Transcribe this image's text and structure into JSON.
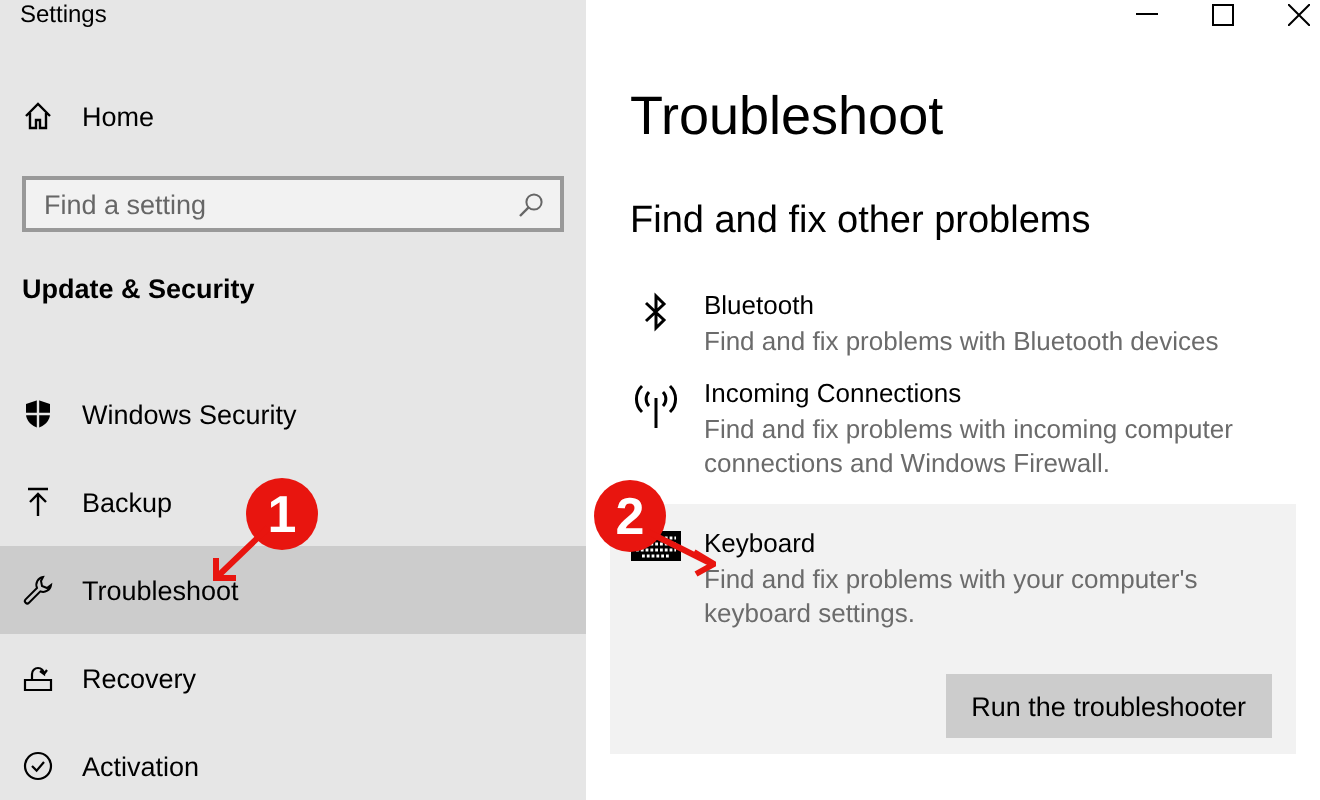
{
  "window": {
    "title": "Settings"
  },
  "sidebar": {
    "home": "Home",
    "search": {
      "placeholder": "Find a setting"
    },
    "heading": "Update & Security",
    "items": [
      {
        "label": "Windows Security",
        "selected": false
      },
      {
        "label": "Backup",
        "selected": false
      },
      {
        "label": "Troubleshoot",
        "selected": true
      },
      {
        "label": "Recovery",
        "selected": false
      },
      {
        "label": "Activation",
        "selected": false
      }
    ]
  },
  "main": {
    "title": "Troubleshoot",
    "subtitle": "Find and fix other problems",
    "troubleshooters": [
      {
        "name": "Bluetooth",
        "description": "Find and fix problems with Bluetooth devices",
        "selected": false
      },
      {
        "name": "Incoming Connections",
        "description": "Find and fix problems with incoming computer connections and Windows Firewall.",
        "selected": false
      },
      {
        "name": "Keyboard",
        "description": "Find and fix problems with your computer's keyboard settings.",
        "selected": true
      }
    ],
    "button": "Run the troubleshooter"
  },
  "callouts": [
    {
      "label": "1"
    },
    {
      "label": "2"
    }
  ]
}
